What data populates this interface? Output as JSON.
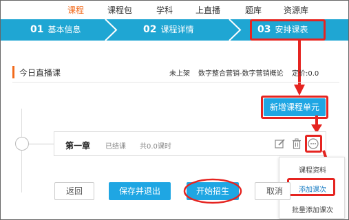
{
  "nav": {
    "items": [
      "课程",
      "课程包",
      "学科",
      "上直播",
      "题库",
      "资源库"
    ],
    "active_index": 0
  },
  "steps": [
    {
      "num": "01",
      "label": "基本信息"
    },
    {
      "num": "02",
      "label": "课程详情"
    },
    {
      "num": "03",
      "label": "安排课表"
    }
  ],
  "course": {
    "title": "今日直播课",
    "status": "未上架",
    "name": "数字整合营销-数字营销概论",
    "price_label": "定价:0.0"
  },
  "buttons": {
    "add_unit": "新增课程单元",
    "back": "返回",
    "save_exit": "保存并退出",
    "start_enroll": "开始招生",
    "cancel": "取消"
  },
  "chapter": {
    "title": "第一章",
    "status": "已结课",
    "hours": "共0.0课时"
  },
  "menu": {
    "items": [
      "课程资料",
      "添加课次",
      "批量添加课次"
    ]
  },
  "colors": {
    "accent": "#f26a1b",
    "primary": "#1fa6e3",
    "highlight": "#e52420"
  }
}
